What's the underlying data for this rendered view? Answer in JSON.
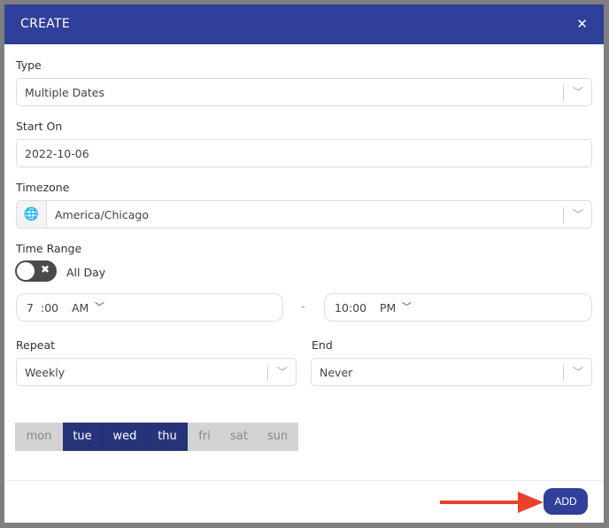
{
  "modal": {
    "title": "CREATE",
    "close_icon": "close-icon"
  },
  "type": {
    "label": "Type",
    "value": "Multiple Dates"
  },
  "start_on": {
    "label": "Start On",
    "value": "2022-10-06"
  },
  "timezone": {
    "label": "Timezone",
    "value": "America/Chicago",
    "icon": "globe-icon"
  },
  "time_range": {
    "label": "Time Range",
    "all_day_label": "All Day",
    "all_day": false,
    "start": {
      "hour": "7",
      "minute": ":00",
      "ampm": "AM"
    },
    "dash": "-",
    "end": {
      "hour": "10",
      "minute": ":00",
      "ampm": "PM"
    }
  },
  "repeat": {
    "label": "Repeat",
    "value": "Weekly"
  },
  "end": {
    "label": "End",
    "value": "Never"
  },
  "days": [
    {
      "label": "mon",
      "selected": false
    },
    {
      "label": "tue",
      "selected": true
    },
    {
      "label": "wed",
      "selected": true
    },
    {
      "label": "thu",
      "selected": true
    },
    {
      "label": "fri",
      "selected": false
    },
    {
      "label": "sat",
      "selected": false
    },
    {
      "label": "sun",
      "selected": false
    }
  ],
  "footer": {
    "add_label": "ADD"
  },
  "colors": {
    "header": "#303f9a",
    "selected_day": "#27347a",
    "arrow": "#e8412c"
  }
}
